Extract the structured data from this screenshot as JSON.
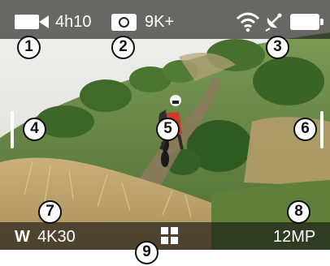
{
  "status": {
    "video_remaining": "4h10",
    "photos_remaining": "9K+"
  },
  "bottom": {
    "lens_mode": "W",
    "video_mode": "4K30",
    "photo_resolution": "12MP"
  },
  "icons": {
    "video": "video-camera-icon",
    "photo": "camera-icon",
    "wifi": "wifi-icon",
    "gps": "gps-satellite-icon",
    "battery": "battery-icon",
    "menu": "grid-menu-icon"
  },
  "callouts": [
    "1",
    "2",
    "3",
    "4",
    "5",
    "6",
    "7",
    "8",
    "9"
  ],
  "colors": {
    "overlay": "#141414",
    "text": "#ffffff",
    "callout_border": "#111111"
  }
}
